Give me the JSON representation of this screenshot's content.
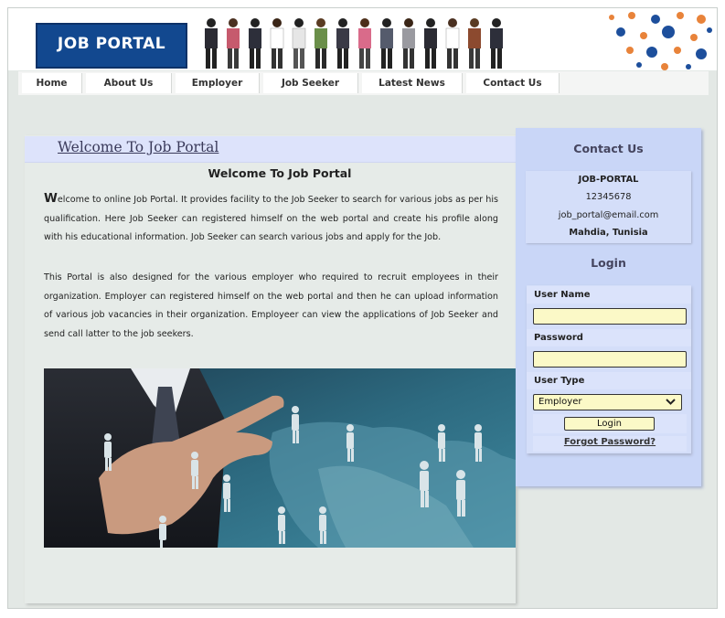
{
  "header": {
    "logo_text": "JOB PORTAL"
  },
  "nav": {
    "items": [
      {
        "label": "Home"
      },
      {
        "label": "About Us"
      },
      {
        "label": "Employer"
      },
      {
        "label": "Job Seeker"
      },
      {
        "label": "Latest News"
      },
      {
        "label": "Contact Us"
      }
    ]
  },
  "main": {
    "welcome_link": "Welcome To Job Portal",
    "title": "Welcome To Job Portal",
    "para1_first_letter": "W",
    "para1_rest": "elcome to online Job Portal. It provides facility to the Job Seeker to search for various jobs as per his qualification. Here Job Seeker can registered himself on the web portal and create his profile along with his educational information. Job Seeker can search various jobs and apply for the Job.",
    "para2": "This Portal is also designed for the various employer who required to recruit employees in their organization. Employer can registered himself on the web portal and then he can upload information of various job vacancies in their organization. Employeer can view the applications of Job Seeker and send call latter to the job seekers."
  },
  "sidebar": {
    "contact_heading": "Contact Us",
    "contact": {
      "name": "JOB-PORTAL",
      "phone": "12345678",
      "email": "job_portal@email.com",
      "location": "Mahdia, Tunisia"
    },
    "login_heading": "Login",
    "login": {
      "username_label": "User Name",
      "username_value": "",
      "password_label": "Password",
      "password_value": "",
      "user_type_label": "User Type",
      "user_type_selected": "Employer",
      "login_button": "Login",
      "forgot_link": "Forgot Password?"
    }
  },
  "colors": {
    "logo_bg": "#12488f",
    "sidebar_bg": "#c9d6f7",
    "input_bg": "#fbf9c7",
    "welcome_bar_bg": "#dde3fb"
  }
}
